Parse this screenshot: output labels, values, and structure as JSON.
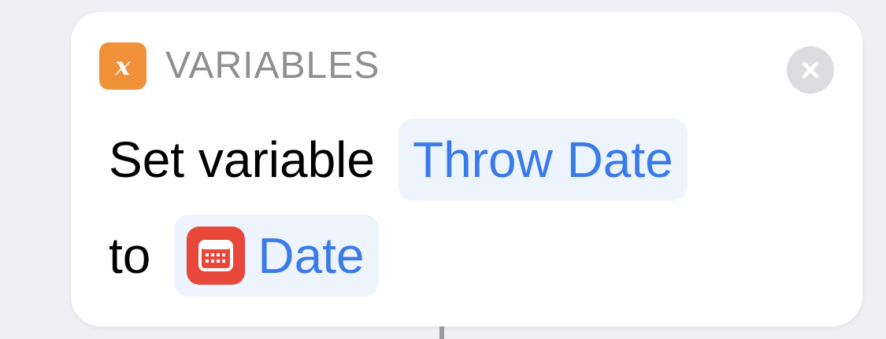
{
  "action": {
    "category_label": "VARIABLES",
    "category_icon_glyph": "x",
    "category_color": "#f0913a",
    "text_before_variable": "Set variable",
    "variable_name": "Throw Date",
    "text_before_value": "to",
    "value_label": "Date",
    "value_icon": "calendar-icon",
    "value_icon_color": "#e8473b",
    "token_text_color": "#3a7bea",
    "close_icon": "close-icon"
  }
}
